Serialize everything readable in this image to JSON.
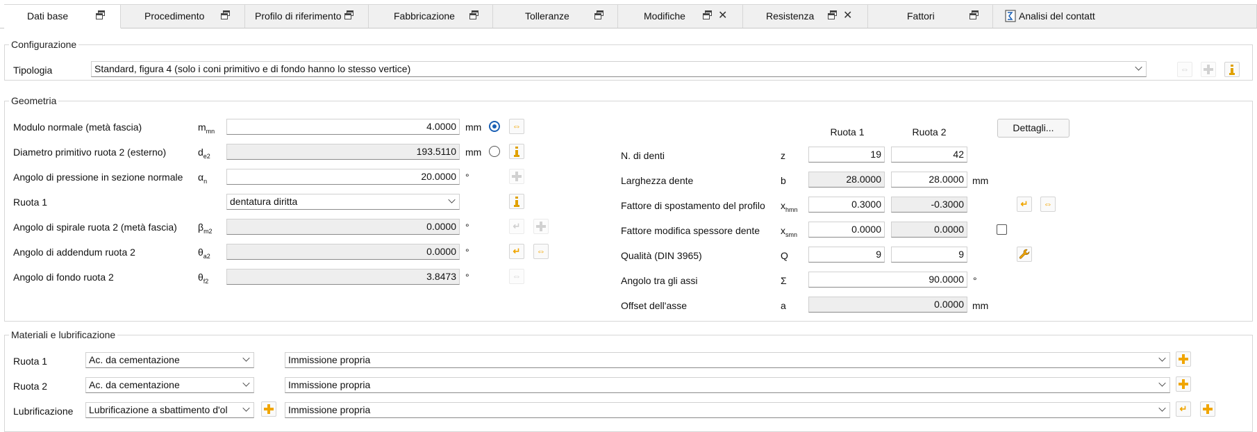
{
  "tabs": [
    {
      "label": "Dati base",
      "active": true,
      "closable": false
    },
    {
      "label": "Procedimento",
      "closable": false
    },
    {
      "label": "Profilo di riferimento",
      "closable": false
    },
    {
      "label": "Fabbricazione",
      "closable": false
    },
    {
      "label": "Tolleranze",
      "closable": false
    },
    {
      "label": "Modifiche",
      "closable": true
    },
    {
      "label": "Resistenza",
      "closable": true
    },
    {
      "label": "Fattori",
      "closable": false
    },
    {
      "label": "Analisi del contatt",
      "closable": false
    }
  ],
  "configurazione": {
    "title": "Configurazione",
    "tipologia_label": "Tipologia",
    "tipologia_value": "Standard, figura 4 (solo i coni primitivo e di fondo hanno lo stesso vertice)"
  },
  "geometria": {
    "title": "Geometria",
    "left_rows": [
      {
        "label": "Modulo normale (metà fascia)",
        "sym": "m",
        "sub": "mn",
        "value": "4.0000",
        "unit": "mm"
      },
      {
        "label": "Diametro primitivo ruota 2 (esterno)",
        "sym": "d",
        "sub": "e2",
        "value": "193.5110",
        "unit": "mm"
      },
      {
        "label": "Angolo di pressione in sezione normale",
        "sym": "α",
        "sub": "n",
        "value": "20.0000",
        "unit": "°"
      },
      {
        "label": "Ruota 1",
        "sym": "",
        "sub": "",
        "value": "dentatura diritta",
        "unit": ""
      },
      {
        "label": "Angolo di spirale ruota 2 (metà fascia)",
        "sym": "β",
        "sub": "m2",
        "value": "0.0000",
        "unit": "°"
      },
      {
        "label": "Angolo di addendum ruota 2",
        "sym": "θ",
        "sub": "a2",
        "value": "0.0000",
        "unit": "°"
      },
      {
        "label": "Angolo di fondo ruota 2",
        "sym": "θ",
        "sub": "f2",
        "value": "3.8473",
        "unit": "°"
      }
    ],
    "col_ruota1": "Ruota 1",
    "col_ruota2": "Ruota 2",
    "dettagli_label": "Dettagli...",
    "right_rows": [
      {
        "label": "N. di denti",
        "sym": "z",
        "sub": "",
        "v1": "19",
        "v2": "42",
        "unit": ""
      },
      {
        "label": "Larghezza dente",
        "sym": "b",
        "sub": "",
        "v1": "28.0000",
        "v2": "28.0000",
        "unit": "mm"
      },
      {
        "label": "Fattore di spostamento del profilo",
        "sym": "x",
        "sub": "hmn",
        "v1": "0.3000",
        "v2": "-0.3000",
        "unit": ""
      },
      {
        "label": "Fattore modifica spessore dente",
        "sym": "x",
        "sub": "smn",
        "v1": "0.0000",
        "v2": "0.0000",
        "unit": ""
      },
      {
        "label": "Qualità (DIN 3965)",
        "sym": "Q",
        "sub": "",
        "v1": "9",
        "v2": "9",
        "unit": ""
      },
      {
        "label": "Angolo tra gli assi",
        "sym": "Σ",
        "sub": "",
        "v": "90.0000",
        "unit": "°"
      },
      {
        "label": "Offset dell'asse",
        "sym": "a",
        "sub": "",
        "v": "0.0000",
        "unit": "mm"
      }
    ]
  },
  "materiali": {
    "title": "Materiali e lubrificazione",
    "rows": [
      {
        "label": "Ruota 1",
        "combo": "Ac. da cementazione",
        "source": "Immissione propria"
      },
      {
        "label": "Ruota 2",
        "combo": "Ac. da cementazione",
        "source": "Immissione propria"
      },
      {
        "label": "Lubrificazione",
        "combo": "Lubrificazione a sbattimento d'ol",
        "source": "Immissione propria"
      }
    ]
  },
  "colors": {
    "accent": "#f0a500",
    "radio": "#1a5fb4"
  }
}
